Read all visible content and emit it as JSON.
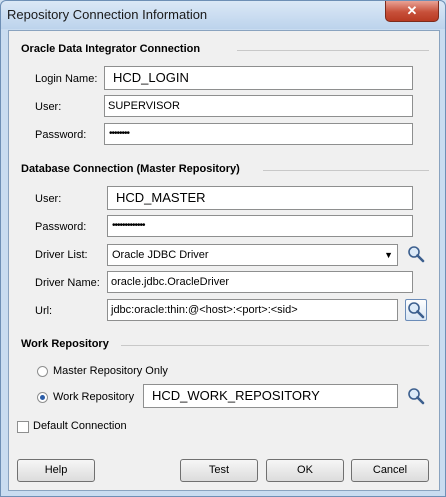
{
  "window": {
    "title": "Repository Connection Information",
    "close_label": "✕"
  },
  "odi": {
    "header": "Oracle Data Integrator Connection",
    "login_name_label": "Login Name:",
    "login_name_value": "HCD_LOGIN",
    "user_label": "User:",
    "user_value": "SUPERVISOR",
    "password_label": "Password:",
    "password_value": "••••••••"
  },
  "db": {
    "header": "Database Connection (Master Repository)",
    "user_label": "User:",
    "user_value": "HCD_MASTER",
    "password_label": "Password:",
    "password_value": "•••••••••••••",
    "driver_list_label": "Driver List:",
    "driver_list_value": "Oracle JDBC Driver",
    "driver_name_label": "Driver Name:",
    "driver_name_value": "oracle.jdbc.OracleDriver",
    "url_label": "Url:",
    "url_value": "jdbc:oracle:thin:@<host>:<port>:<sid>"
  },
  "work": {
    "header": "Work Repository",
    "master_only_label": "Master Repository Only",
    "work_repo_label": "Work Repository",
    "work_repo_value": "HCD_WORK_REPOSITORY",
    "selected": "Work Repository"
  },
  "default_connection_label": "Default Connection",
  "default_connection_checked": false,
  "buttons": {
    "help": "Help",
    "test": "Test",
    "ok": "OK",
    "cancel": "Cancel"
  }
}
